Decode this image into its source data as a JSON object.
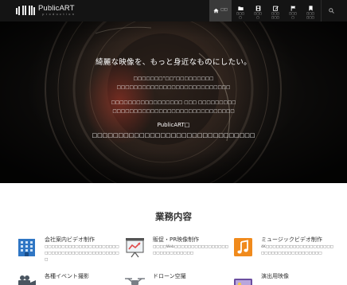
{
  "header": {
    "logo_name": "PublicART",
    "logo_sub": "p r o d u c t i o n",
    "nav": [
      {
        "label": "□□",
        "icon": "home-icon",
        "active": true
      },
      {
        "label": "□□□□",
        "icon": "folder-icon"
      },
      {
        "label": "□□□□",
        "icon": "film-icon"
      },
      {
        "label": "□□□□□□",
        "icon": "edit-icon"
      },
      {
        "label": "□□□□",
        "icon": "flag-icon"
      },
      {
        "label": "□□□□□□",
        "icon": "bookmark-icon"
      }
    ],
    "search_icon": "search-icon"
  },
  "hero": {
    "title": "綺麗な映像を、もっと身近なものにしたい。",
    "para1_line1": "□□□□□□□“□□”□□□□□□□□□",
    "para1_line2": "□□□□□□□□□□□□□□□□□□□□□□□□□□□",
    "para2_line1": "□□□□□□□□□□□□□□□□□ □□□ □□□□□□□□□",
    "para2_line2": "□□□□□□□□□□□□□□□□□□□□□□□□□□□□□",
    "brand": "PublicART□",
    "tagline": "□□□□□□□□□□□□□□□□□□□□□□□□□□□□□□□"
  },
  "services": {
    "title": "業務内容",
    "items": [
      {
        "title": "会社案内ビデオ制作",
        "desc": "□□□□□□□□□□□□□□□□□□□□□□□□□□□□□□□□□□□□□□□□□□□□□",
        "icon": "building-icon",
        "color": "#2f76c4"
      },
      {
        "title": "販促・PR映像制作",
        "desc": "□□□□Web□□□□□□□□□□□□□□□□□□□□□□□□□□□□",
        "icon": "presentation-icon",
        "color": "#e04b4b"
      },
      {
        "title": "ミュージックビデオ制作",
        "desc": "4K□□□□□□□□□□□□□□□□□□□□□□□□□□□□□□□□□□□□□□",
        "icon": "music-icon",
        "color": "#f08a1c"
      },
      {
        "title": "各種イベント撮影",
        "icon": "video-camera-icon",
        "color": "#4a5560"
      },
      {
        "title": "ドローン空撮",
        "icon": "drone-icon",
        "color": "#7a7f86"
      },
      {
        "title": "演出用映像",
        "icon": "monitor-icon",
        "color": "#6b4ea0"
      }
    ]
  }
}
